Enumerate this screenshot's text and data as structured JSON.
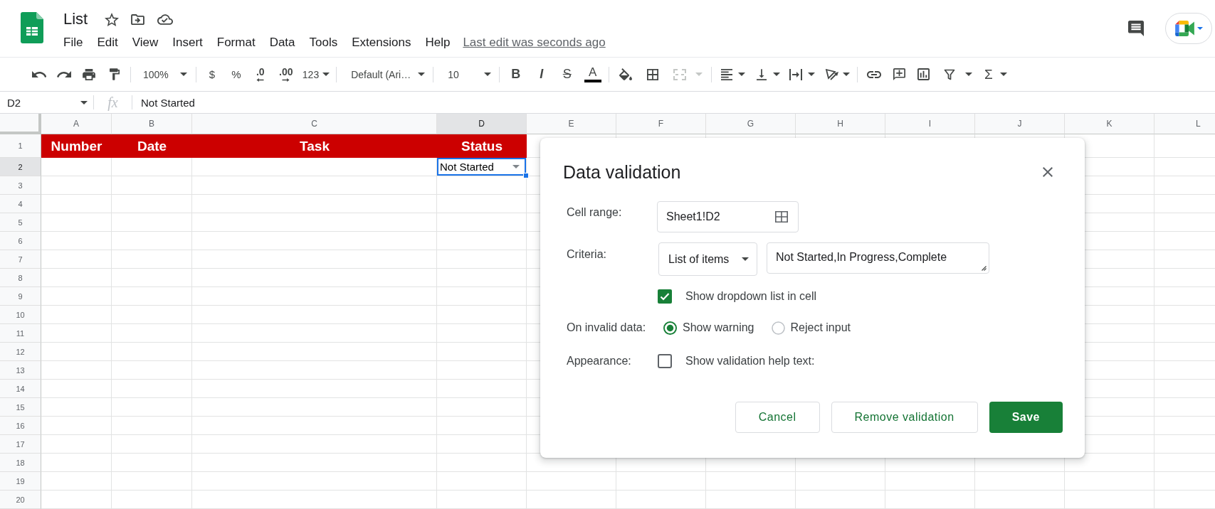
{
  "header": {
    "title": "List",
    "menu": [
      "File",
      "Edit",
      "View",
      "Insert",
      "Format",
      "Data",
      "Tools",
      "Extensions",
      "Help"
    ],
    "last_edit": "Last edit was seconds ago"
  },
  "toolbar": {
    "zoom": "100%",
    "currency": "$",
    "percent": "%",
    "decrease_decimal": ".0",
    "increase_decimal": ".00",
    "number_format": "123",
    "font": "Default (Ari…",
    "font_size": "10",
    "bold": "B",
    "italic": "I",
    "strikethrough": "S",
    "text_color": "A",
    "merge_cells": {
      "disabled": true
    },
    "functions": "Σ"
  },
  "formula_bar": {
    "name_box": "D2",
    "fx": "fx",
    "value": "Not Started"
  },
  "sheet": {
    "columns": [
      {
        "label": "A",
        "selected": false
      },
      {
        "label": "B",
        "selected": false
      },
      {
        "label": "C",
        "selected": false
      },
      {
        "label": "D",
        "selected": true
      },
      {
        "label": "E",
        "selected": false
      },
      {
        "label": "F",
        "selected": false
      },
      {
        "label": "G",
        "selected": false
      },
      {
        "label": "H",
        "selected": false
      },
      {
        "label": "I",
        "selected": false
      },
      {
        "label": "J",
        "selected": false
      },
      {
        "label": "K",
        "selected": false
      },
      {
        "label": "L",
        "selected": false
      }
    ],
    "rows": [
      {
        "label": "1",
        "selected": false,
        "cells": [
          {
            "value": "Number",
            "kind": "header",
            "selected": false
          },
          {
            "value": "Date",
            "kind": "header",
            "selected": false
          },
          {
            "value": "Task",
            "kind": "header",
            "selected": false
          },
          {
            "value": "Status",
            "kind": "header",
            "selected": false
          }
        ]
      },
      {
        "label": "2",
        "selected": true,
        "cells": [
          null,
          null,
          null,
          {
            "value": "Not Started",
            "kind": "dropdown",
            "selected": true
          }
        ]
      },
      {
        "label": "3",
        "selected": false
      },
      {
        "label": "4",
        "selected": false
      },
      {
        "label": "5",
        "selected": false
      },
      {
        "label": "6",
        "selected": false
      },
      {
        "label": "7",
        "selected": false
      },
      {
        "label": "8",
        "selected": false
      },
      {
        "label": "9",
        "selected": false
      },
      {
        "label": "10",
        "selected": false
      },
      {
        "label": "11",
        "selected": false
      },
      {
        "label": "12",
        "selected": false
      },
      {
        "label": "13",
        "selected": false
      },
      {
        "label": "14",
        "selected": false
      },
      {
        "label": "15",
        "selected": false
      },
      {
        "label": "16",
        "selected": false
      },
      {
        "label": "17",
        "selected": false
      },
      {
        "label": "18",
        "selected": false
      },
      {
        "label": "19",
        "selected": false
      },
      {
        "label": "20",
        "selected": false
      }
    ]
  },
  "dialog": {
    "title": "Data validation",
    "cell_range": {
      "label": "Cell range:",
      "value": "Sheet1!D2"
    },
    "criteria": {
      "label": "Criteria:",
      "type": "List of items",
      "value": "Not Started,In Progress,Complete"
    },
    "show_dropdown": {
      "label": "Show dropdown list in cell",
      "checked": true
    },
    "invalid_data": {
      "label": "On invalid data:",
      "options": [
        {
          "label": "Show warning",
          "selected": true
        },
        {
          "label": "Reject input",
          "selected": false
        }
      ]
    },
    "appearance": {
      "label": "Appearance:",
      "help_text": {
        "label": "Show validation help text:",
        "checked": false
      }
    },
    "buttons": [
      {
        "label": "Cancel",
        "kind": "secondary"
      },
      {
        "label": "Remove validation",
        "kind": "secondary"
      },
      {
        "label": "Save",
        "kind": "primary"
      }
    ]
  }
}
